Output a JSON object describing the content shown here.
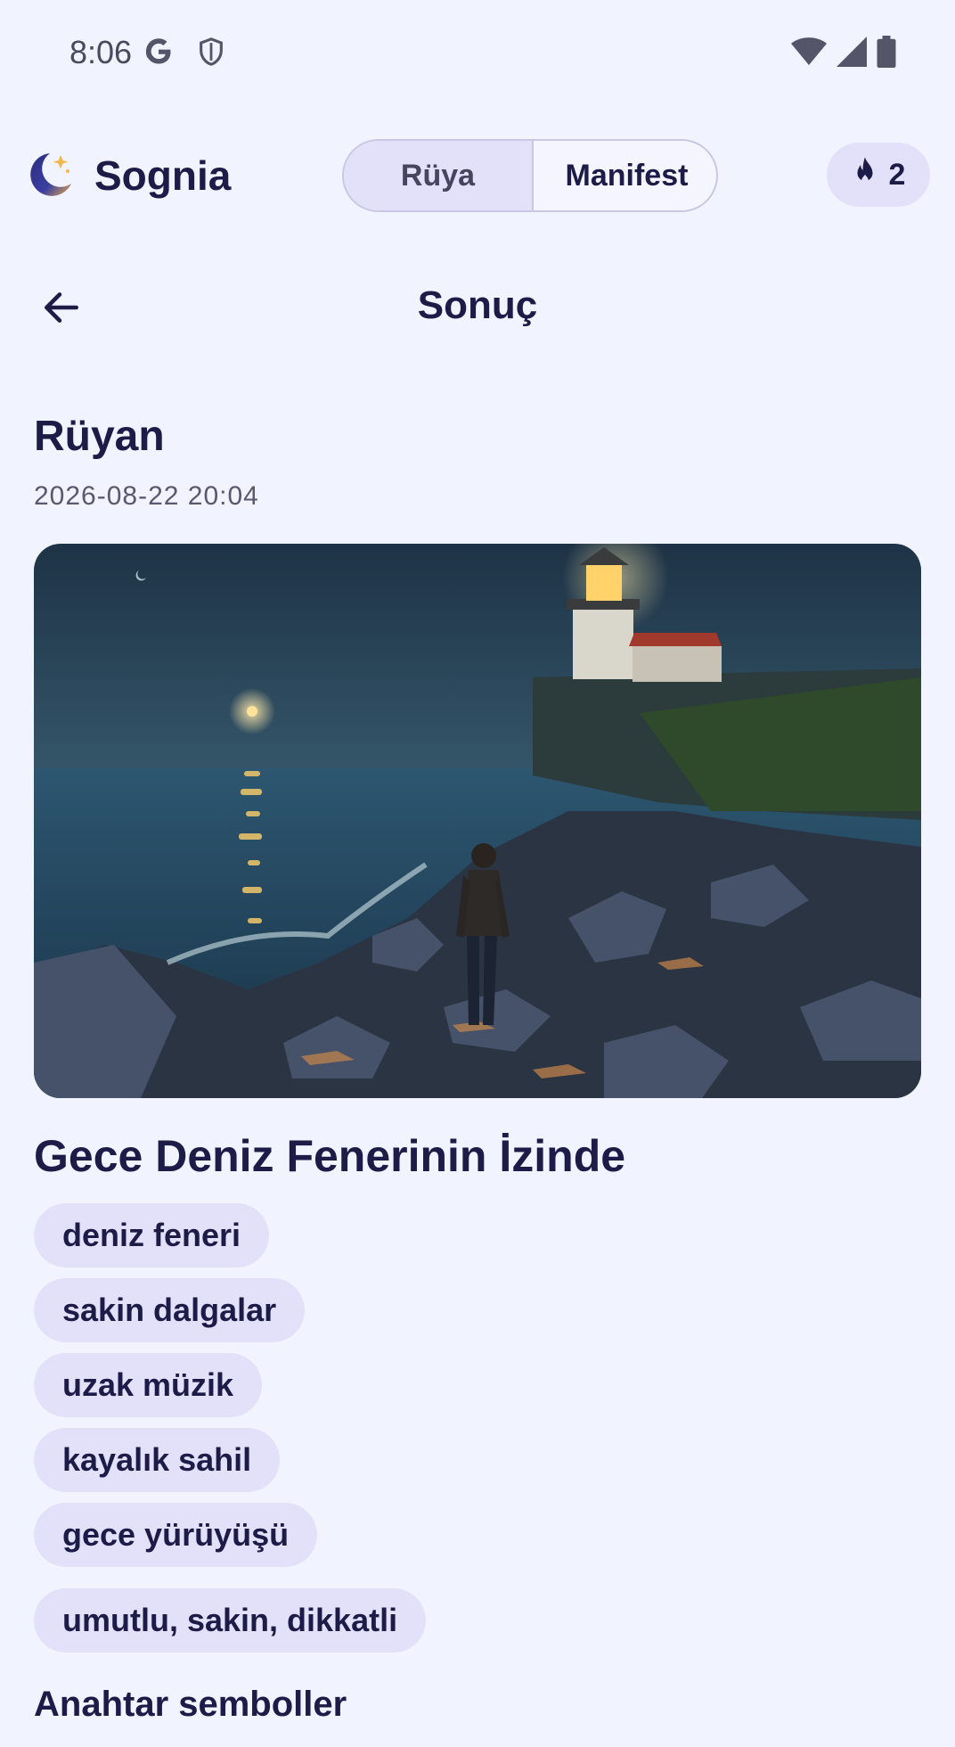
{
  "status_bar": {
    "time": "8:06",
    "icons": [
      "google-icon",
      "shield-icon",
      "wifi-icon",
      "signal-icon",
      "battery-icon"
    ]
  },
  "app_bar": {
    "title": "Sognia",
    "tabs": [
      {
        "label": "Rüya",
        "active": true
      },
      {
        "label": "Manifest",
        "active": false
      }
    ],
    "streak_count": "2"
  },
  "header": {
    "title": "Sonuç"
  },
  "dream": {
    "section_title": "Rüyan",
    "date": "2026-08-22 20:04",
    "title": "Gece Deniz Fenerinin İzinde",
    "tags": [
      "deniz feneri",
      "sakin dalgalar",
      "uzak müzik",
      "kayalık sahil",
      "gece yürüyüşü"
    ],
    "mood": "umutlu, sakin, dikkatli"
  },
  "symbols": {
    "title": "Anahtar semboller"
  },
  "colors": {
    "background": "#f1f3fe",
    "chip": "#e3e1fa",
    "text": "#1d1b47"
  }
}
